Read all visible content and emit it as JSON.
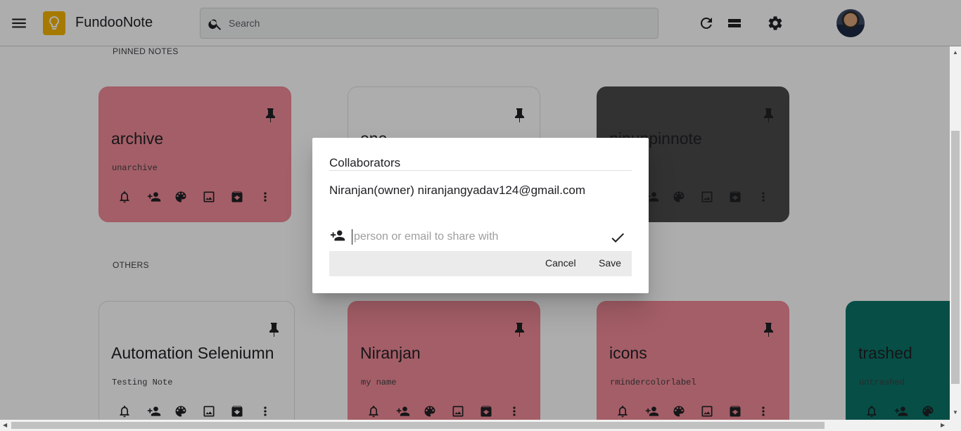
{
  "header": {
    "app_title": "FundooNote",
    "search_placeholder": "Search",
    "icons": [
      "menu-icon",
      "bulb-icon",
      "search-icon",
      "refresh-icon",
      "list-view-icon",
      "settings-icon"
    ]
  },
  "sections": {
    "pinned_label": "PINNED NOTES",
    "others_label": "OTHERS"
  },
  "notes": {
    "pinned": [
      {
        "title": "archive",
        "body": "unarchive",
        "color": "#f28b99"
      },
      {
        "title": "one",
        "body": "",
        "color": "#ffffff"
      },
      {
        "title": "pinunpinnote",
        "body": "",
        "color": "#4a4a4a"
      }
    ],
    "others": [
      {
        "title": "Automation Seleniumn",
        "body": "Testing Note",
        "color": "#ffffff"
      },
      {
        "title": "Niranjan",
        "body": "my name",
        "color": "#f28b99"
      },
      {
        "title": "icons",
        "body": "rmindercolorlabel",
        "color": "#f28b99"
      },
      {
        "title": "trashed",
        "body": "untrashed",
        "color": "#0b7368"
      }
    ]
  },
  "dialog": {
    "title": "Collaborators",
    "owner_line": "Niranjan(owner) niranjangyadav124@gmail.com",
    "input_placeholder": "person or email to share with",
    "cancel_label": "Cancel",
    "save_label": "Save"
  }
}
